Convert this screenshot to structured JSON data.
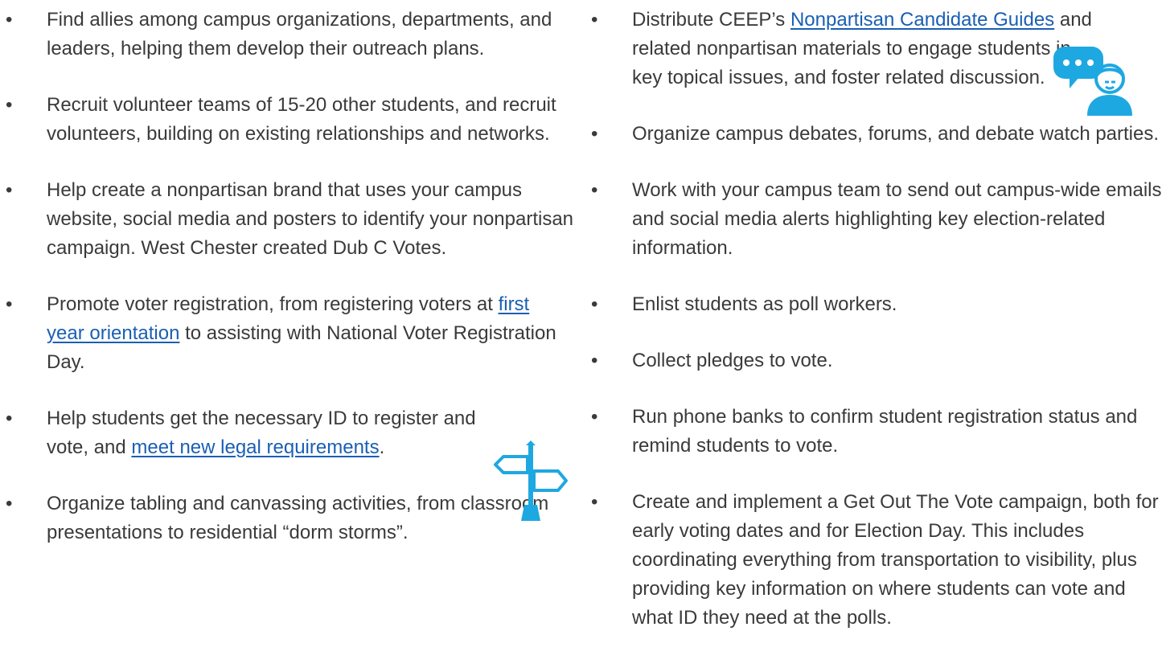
{
  "colors": {
    "text": "#3a3a3a",
    "link": "#1a5fb4",
    "icon_blue": "#1ea8e1"
  },
  "left_column": {
    "items": [
      {
        "text_before": "Find allies among campus organizations, departments, and leaders, helping them develop their outreach plans.",
        "link": "",
        "text_after": ""
      },
      {
        "text_before": "Recruit volunteer teams of 15-20 other students, and recruit volunteers, building on existing relationships and networks.",
        "link": "",
        "text_after": ""
      },
      {
        "text_before": "Help create a nonpartisan brand that uses your campus website, social media and posters to identify your nonpartisan campaign. West Chester created Dub C Votes.",
        "link": "",
        "text_after": ""
      },
      {
        "text_before": "Promote voter registration, from registering voters at ",
        "link": "first year orientation",
        "text_after": " to assisting with National Voter Registration Day."
      },
      {
        "text_before": "Help students get the necessary ID to register and vote, and ",
        "link": "meet new legal requirements",
        "text_after": "."
      },
      {
        "text_before": "Organize tabling and canvassing activities, from classroom presentations to residential “dorm storms”.",
        "link": "",
        "text_after": ""
      }
    ]
  },
  "right_column": {
    "items": [
      {
        "text_before": "Distribute CEEP’s ",
        "link": "Nonpartisan Candidate Guides",
        "text_after": " and related nonpartisan materials to engage students in key topical issues, and foster related discussion."
      },
      {
        "text_before": "Organize campus debates, forums, and debate watch parties.",
        "link": "",
        "text_after": ""
      },
      {
        "text_before": "Work with your campus team to send out campus-wide emails and social media alerts highlighting key election-related information.",
        "link": "",
        "text_after": ""
      },
      {
        "text_before": "Enlist students as poll workers.",
        "link": "",
        "text_after": ""
      },
      {
        "text_before": "Collect pledges to vote.",
        "link": "",
        "text_after": ""
      },
      {
        "text_before": "Run phone banks to confirm student registration status and remind students to vote.",
        "link": "",
        "text_after": ""
      },
      {
        "text_before": "Create and implement a Get Out The Vote campaign, both for early voting dates and for Election Day. This includes coordinating everything from transportation to visibility, plus providing key information on where students can vote and what ID they need at the polls.",
        "link": "",
        "text_after": ""
      }
    ]
  },
  "icons": {
    "signpost": "signpost-icon",
    "chat_person": "chat-person-icon"
  }
}
